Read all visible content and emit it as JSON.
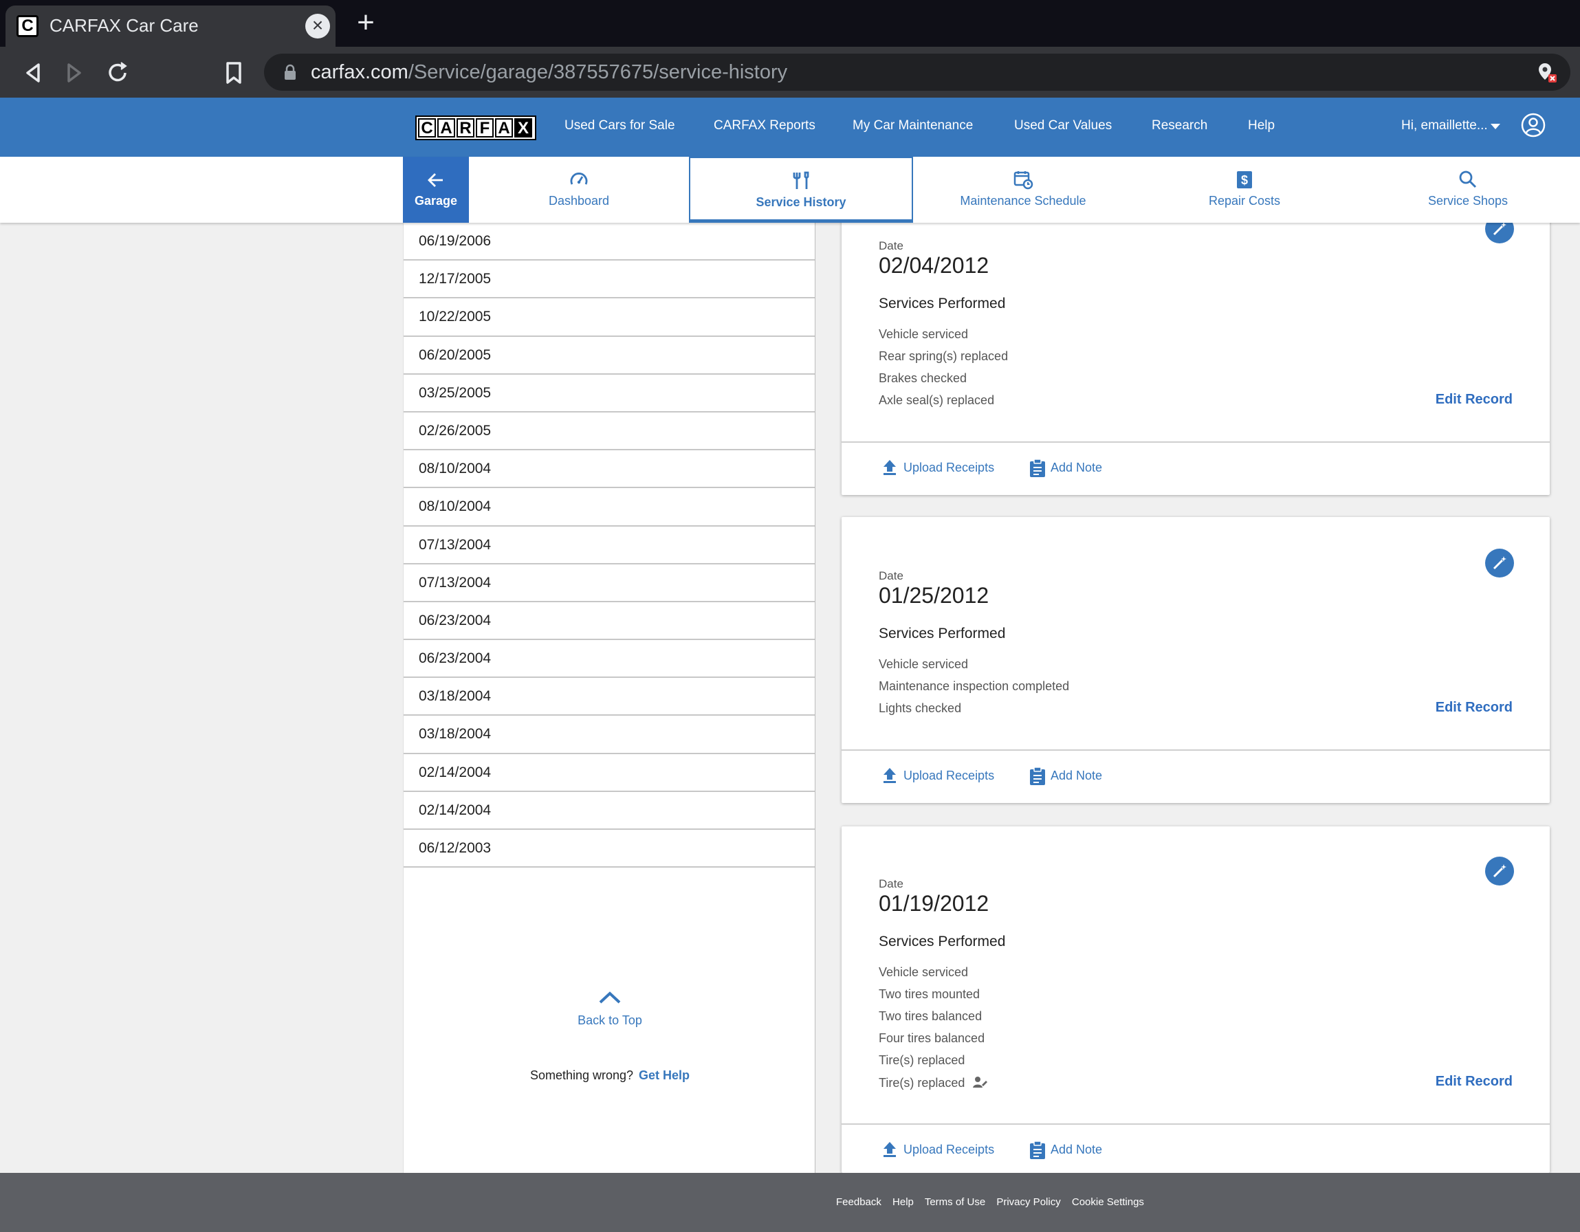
{
  "browser": {
    "tab_title": "CARFAX Car Care",
    "url_host": "carfax.com",
    "url_path": "/Service/garage/387557675/service-history"
  },
  "header": {
    "logo_letters": [
      "C",
      "A",
      "R",
      "F",
      "A",
      "X"
    ],
    "nav": [
      "Used Cars for Sale",
      "CARFAX Reports",
      "My Car Maintenance",
      "Used Car Values",
      "Research",
      "Help"
    ],
    "user": "Hi, emaillette..."
  },
  "subnav": {
    "garage": "Garage",
    "tabs": [
      "Dashboard",
      "Service History",
      "Maintenance Schedule",
      "Repair Costs",
      "Service Shops"
    ],
    "active": "Service History"
  },
  "dates": [
    "06/19/2006",
    "12/17/2005",
    "10/22/2005",
    "06/20/2005",
    "03/25/2005",
    "02/26/2005",
    "08/10/2004",
    "08/10/2004",
    "07/13/2004",
    "07/13/2004",
    "06/23/2004",
    "06/23/2004",
    "03/18/2004",
    "03/18/2004",
    "02/14/2004",
    "02/14/2004",
    "06/12/2003"
  ],
  "back_to_top": "Back to Top",
  "help": {
    "prompt": "Something wrong?",
    "link": "Get Help"
  },
  "records": [
    {
      "date_label": "Date",
      "date": "02/04/2012",
      "section": "Services Performed",
      "services": [
        "Vehicle serviced",
        "Rear spring(s) replaced",
        "Brakes checked",
        "Axle seal(s) replaced"
      ],
      "edit": "Edit Record",
      "upload": "Upload Receipts",
      "note": "Add Note"
    },
    {
      "date_label": "Date",
      "date": "01/25/2012",
      "section": "Services Performed",
      "services": [
        "Vehicle serviced",
        "Maintenance inspection completed",
        "Lights checked"
      ],
      "edit": "Edit Record",
      "upload": "Upload Receipts",
      "note": "Add Note"
    },
    {
      "date_label": "Date",
      "date": "01/19/2012",
      "section": "Services Performed",
      "services": [
        "Vehicle serviced",
        "Two tires mounted",
        "Two tires balanced",
        "Four tires balanced",
        "Tire(s) replaced",
        "Tire(s) replaced"
      ],
      "edit": "Edit Record",
      "upload": "Upload Receipts",
      "note": "Add Note"
    }
  ],
  "footer": [
    "Feedback",
    "Help",
    "Terms of Use",
    "Privacy Policy",
    "Cookie Settings"
  ],
  "colors": {
    "brand_blue": "#3777bc",
    "footer": "#5d5f64"
  }
}
